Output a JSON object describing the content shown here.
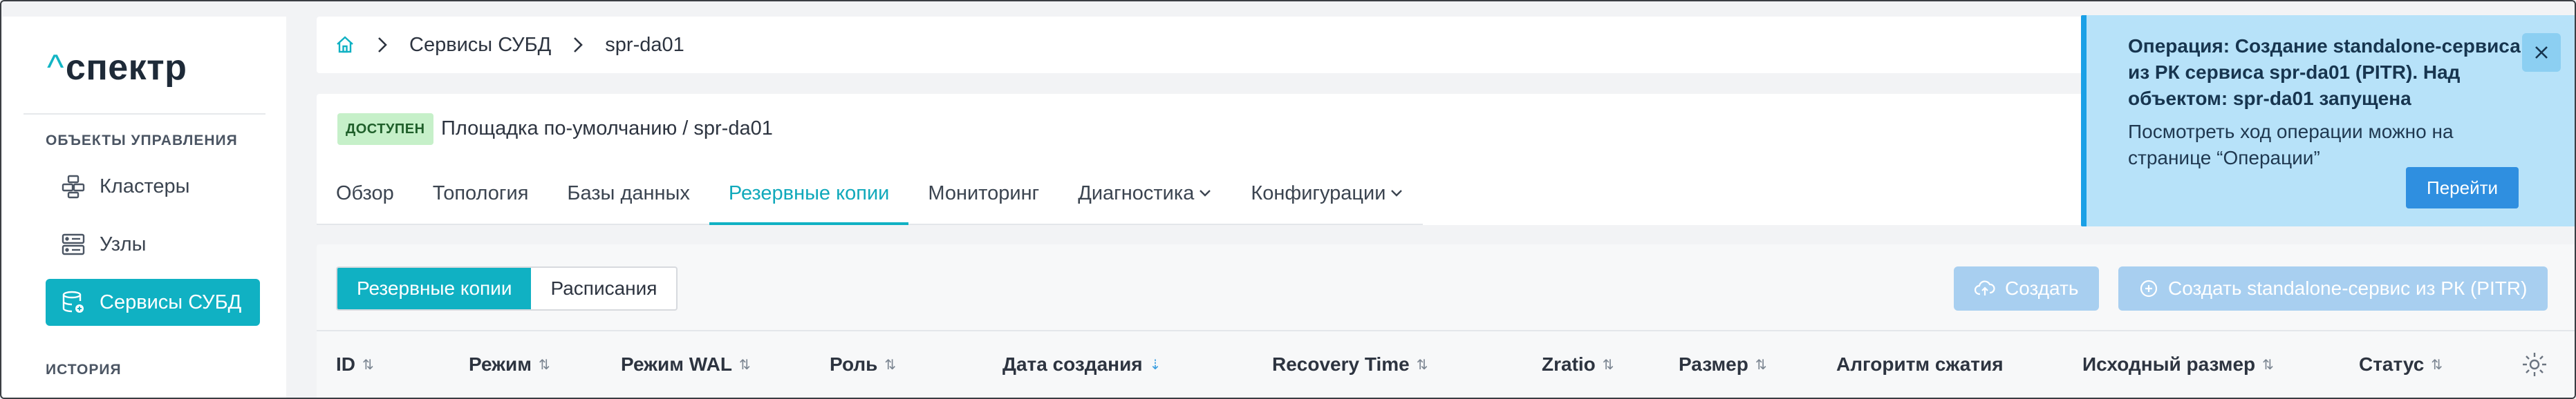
{
  "sidebar": {
    "logo": {
      "caret": "^",
      "text": "спектр"
    },
    "section_management": "ОБЪЕКТЫ УПРАВЛЕНИЯ",
    "items": [
      {
        "label": "Кластеры",
        "icon": "clusters-icon"
      },
      {
        "label": "Узлы",
        "icon": "servers-icon"
      },
      {
        "label": "Сервисы СУБД",
        "icon": "database-services-icon",
        "active": true
      }
    ],
    "section_history": "ИСТОРИЯ"
  },
  "breadcrumb": {
    "home_icon": "home-icon",
    "items": [
      "Сервисы СУБД",
      "spr-da01"
    ]
  },
  "header": {
    "status": "ДОСТУПЕН",
    "path": "Площадка по-умолчанию /  spr-da01"
  },
  "tabs": [
    {
      "label": "Обзор"
    },
    {
      "label": "Топология"
    },
    {
      "label": "Базы данных"
    },
    {
      "label": "Резервные копии",
      "active": true
    },
    {
      "label": "Мониторинг"
    },
    {
      "label": "Диагностика",
      "dropdown": true
    },
    {
      "label": "Конфигурации",
      "dropdown": true
    }
  ],
  "content": {
    "segments": [
      "Резервные копии",
      "Расписания"
    ],
    "create_button": "Создать",
    "create_standalone_button": "Создать standalone-сервис из РК (PITR)",
    "columns": [
      "ID",
      "Режим",
      "Режим WAL",
      "Роль",
      "Дата создания",
      "Recovery Time",
      "Zratio",
      "Размер",
      "Алгоритм сжатия",
      "Исходный размер",
      "Статус"
    ]
  },
  "toast": {
    "title": "Операция: Создание standalone-сервиса из РК сервиса spr-da01 (PITR). Над объектом: spr-da01 запущена",
    "text": "Посмотреть ход операции можно на странице “Операции”",
    "button": "Перейти"
  },
  "colors": {
    "accent": "#10b1c3",
    "status_bg": "#c6f0c9",
    "toast_bg": "#b7e2f9",
    "toast_border": "#1aa0e6",
    "disabled_button": "#a8cff0"
  }
}
